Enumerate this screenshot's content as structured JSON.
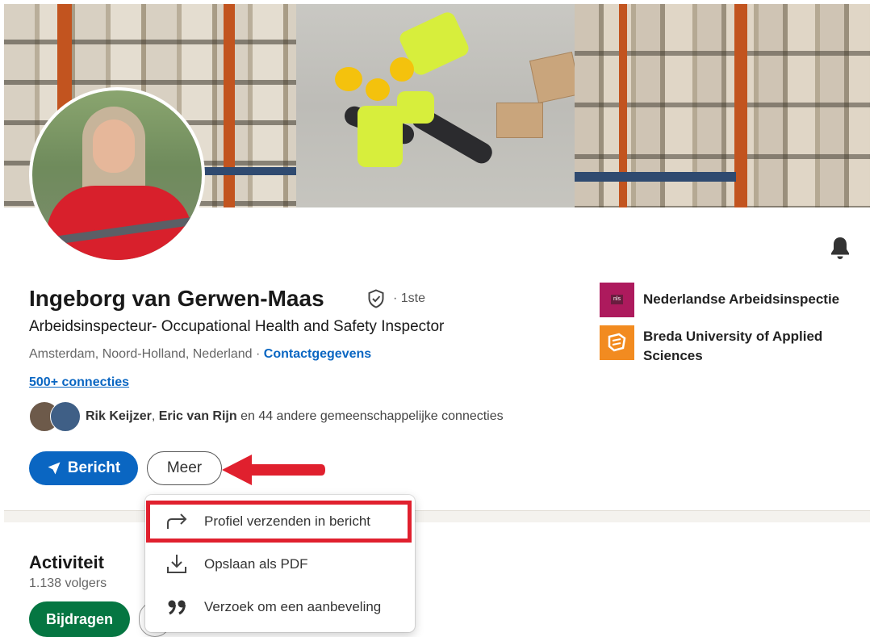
{
  "profile": {
    "name": "Ingeborg van Gerwen-Maas",
    "degree": "· 1ste",
    "headline": "Arbeidsinspecteur- Occupational Health and Safety Inspector",
    "location": "Amsterdam, Noord-Holland, Nederland",
    "location_separator": " · ",
    "contact_link": "Contactgegevens",
    "connections": "500+ connecties",
    "mutual": {
      "name1": "Rik Keijzer",
      "separator": ", ",
      "name2": "Eric van Rijn",
      "rest": " en 44 andere gemeenschappelijke connecties"
    }
  },
  "actions": {
    "message_label": "Bericht",
    "more_label": "Meer"
  },
  "companies": [
    {
      "name": "Nederlandse Arbeidsinspectie",
      "logo_text": "nls",
      "color": "#ad1a5d"
    },
    {
      "name": "Breda University of Applied Sciences",
      "color": "#f28b20"
    }
  ],
  "dropdown": {
    "items": [
      {
        "label": "Profiel verzenden in bericht",
        "icon": "share-arrow-icon"
      },
      {
        "label": "Opslaan als PDF",
        "icon": "download-icon"
      },
      {
        "label": "Verzoek om een aanbeveling",
        "icon": "quote-icon"
      }
    ]
  },
  "activity": {
    "title": "Activiteit",
    "followers": "1.138 volgers",
    "button_label": "Bijdragen"
  },
  "colors": {
    "primary": "#0a66c2",
    "success": "#057642",
    "annotation": "#e0202e"
  }
}
